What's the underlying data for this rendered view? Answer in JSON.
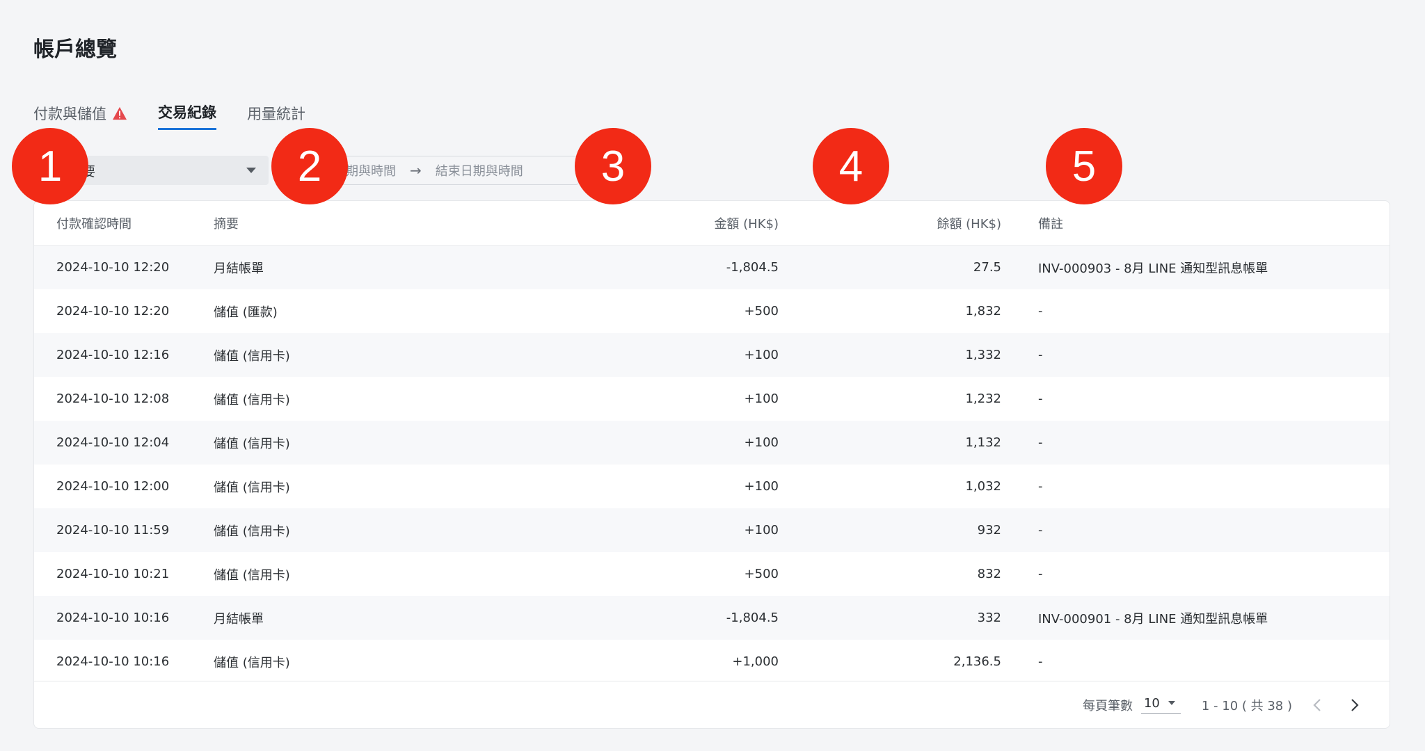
{
  "page": {
    "title": "帳戶總覽"
  },
  "tabs": [
    {
      "label": "付款與儲值",
      "has_warning": true
    },
    {
      "label": "交易紀錄",
      "active": true
    },
    {
      "label": "用量統計"
    }
  ],
  "filters": {
    "summary_select_value": "要",
    "date_range": {
      "start_placeholder": "期與時間",
      "separator": "→",
      "end_placeholder": "結束日期與時間"
    }
  },
  "table": {
    "columns": [
      "付款確認時間",
      "摘要",
      "金額 (HK$)",
      "餘額 (HK$)",
      "備註"
    ],
    "rows": [
      {
        "time": "2024-10-10 12:20",
        "desc": "月結帳單",
        "amount": "-1,804.5",
        "balance": "27.5",
        "note": "INV-000903 - 8月 LINE 通知型訊息帳單"
      },
      {
        "time": "2024-10-10 12:20",
        "desc": "儲值 (匯款)",
        "amount": "+500",
        "balance": "1,832",
        "note": "-"
      },
      {
        "time": "2024-10-10 12:16",
        "desc": "儲值 (信用卡)",
        "amount": "+100",
        "balance": "1,332",
        "note": "-"
      },
      {
        "time": "2024-10-10 12:08",
        "desc": "儲值 (信用卡)",
        "amount": "+100",
        "balance": "1,232",
        "note": "-"
      },
      {
        "time": "2024-10-10 12:04",
        "desc": "儲值 (信用卡)",
        "amount": "+100",
        "balance": "1,132",
        "note": "-"
      },
      {
        "time": "2024-10-10 12:00",
        "desc": "儲值 (信用卡)",
        "amount": "+100",
        "balance": "1,032",
        "note": "-"
      },
      {
        "time": "2024-10-10 11:59",
        "desc": "儲值 (信用卡)",
        "amount": "+100",
        "balance": "932",
        "note": "-"
      },
      {
        "time": "2024-10-10 10:21",
        "desc": "儲值 (信用卡)",
        "amount": "+500",
        "balance": "832",
        "note": "-"
      },
      {
        "time": "2024-10-10 10:16",
        "desc": "月結帳單",
        "amount": "-1,804.5",
        "balance": "332",
        "note": "INV-000901 - 8月 LINE 通知型訊息帳單"
      },
      {
        "time": "2024-10-10 10:16",
        "desc": "儲值 (信用卡)",
        "amount": "+1,000",
        "balance": "2,136.5",
        "note": "-"
      }
    ]
  },
  "pagination": {
    "per_page_label": "每頁筆數",
    "per_page_value": "10",
    "range_text": "1 - 10 ( 共 38 )",
    "prev_icon": "chevron-left-icon",
    "next_icon": "chevron-right-icon"
  },
  "markers": [
    "1",
    "2",
    "3",
    "4",
    "5"
  ],
  "colors": {
    "accent": "#1b73d8",
    "warning": "#e5484d",
    "marker": "#f22a16"
  }
}
